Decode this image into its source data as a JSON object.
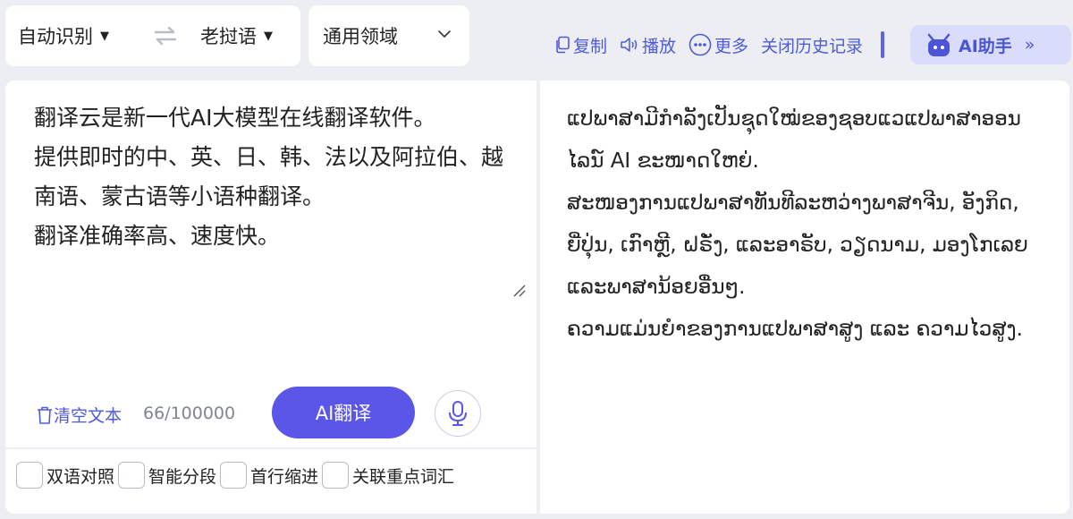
{
  "languages": {
    "source": "自动识别",
    "target": "老挝语"
  },
  "domain": {
    "selected": "通用领域"
  },
  "toolbar": {
    "copy": "复制",
    "play": "播放",
    "more": "更多",
    "close_history": "关闭历史记录",
    "ai_assistant": "AI助手"
  },
  "source": {
    "text": "翻译云是新一代AI大模型在线翻译软件。\n提供即时的中、英、日、韩、法以及阿拉伯、越南语、蒙古语等小语种翻译。\n翻译准确率高、速度快。",
    "clear_label": "清空文本",
    "char_count": "66/100000"
  },
  "actions": {
    "translate": "AI翻译"
  },
  "options": [
    {
      "label": "双语对照",
      "checked": false
    },
    {
      "label": "智能分段",
      "checked": false
    },
    {
      "label": "首行缩进",
      "checked": false
    },
    {
      "label": "关联重点词汇",
      "checked": false
    }
  ],
  "target": {
    "text": "ແປພາສາມີກຳລັງເປັນຊຸດໃໝ່ຂອງຊອບແວແປພາສາອອນໄລນ໌ AI ຂະໜາດໃຫຍ່.\nສະໜອງການແປພາສາທັນທີລະຫວ່າງພາສາຈີນ, ອັງກິດ, ຍີ່ປຸ່ນ, ເກົາຫຼີ, ຝຣັ່ງ, ແລະອາຣັບ, ວຽດນາມ, ມອງໂກເລຍ ແລະພາສານ້ອຍອື່ນໆ.\nຄວາມແມ່ນຍຳຂອງການແປພາສາສູງ ແລະ ຄວາມໄວສູງ."
  },
  "colors": {
    "accent": "#5b55e8",
    "link": "#4e5bd8",
    "background": "#eceef3"
  }
}
